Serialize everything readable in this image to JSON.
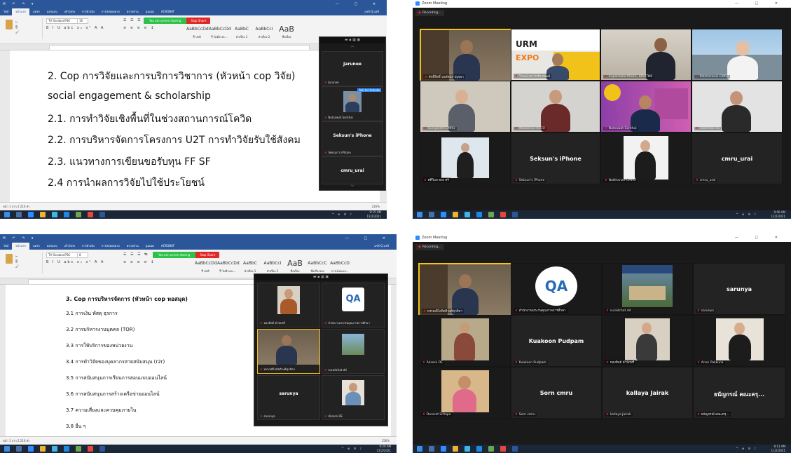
{
  "word_top": {
    "doc_lines": [
      "2. Cop การวิจัยและการบริการวิชาการ (หัวหน้า cop วิจัย)",
      "social engagement & scholarship",
      "2.1. การทำวิจัยเชิงพื้นที่ในช่วงสถานการณ์โควิด",
      "2.2. การบริหารจัดการโครงการ U2T การทำวิจัยรับใช้สังคม",
      "2.3. แนวทางการเขียนขอรับทุน FF  SF",
      "2.4 การนำผลการวิจัยไปใช้ประโยชน์"
    ],
    "font_box": "TH SarabunPSK",
    "font_size": "16",
    "share_text": "You are screen sharing",
    "stop_share": "Stop Share",
    "panel": {
      "tile1_name": "Jarunee",
      "tile1_mic_name": "Jarunee",
      "tile2_name": "Nutsawat Sonthai",
      "tile3_name": "Seksun's iPhone",
      "tile3_mic_name": "Seksun's iPhone",
      "tile4_name": "cmru_urai",
      "tile2_btn": "Ask to Unmute"
    },
    "tab_active": "หน้าแรก",
    "tabs_right": "แชร์ Q แชร์",
    "styles": [
      "AaBbCcDd",
      "AaBbCcDd",
      "AaBbC",
      "AaBbCcI",
      "AaB",
      "AaBbCcC",
      "AaBbCcD"
    ],
    "style_names": [
      "¶ ปกติ",
      "¶ ไม่มีระยะ...",
      "หัวเรื่อง 1",
      "หัวเรื่อง 2",
      "ชื่อเรื่อง",
      "ชื่อเรื่องรอง",
      "การเน้นแบบ..."
    ],
    "status_left": "หน้า 1 จาก 2   210 คำ",
    "status_right": "216%",
    "clock_time": "9:15 AM",
    "clock_date": "12/2/2021"
  },
  "word_bottom": {
    "doc_lines": [
      "3. Cop การบริหารจัดการ (หัวหน้า cop หอสมุด)",
      "3.1 การเงิน พัสดุ ธุรการ",
      "3.2 การบริหารงานบุคคล (TOR)",
      "3.3 การให้บริการของหน่วยงาน",
      "3.4 การทำวิจัยของบุคลากรสายสนับสนุน (r2r)",
      "3.5 การสนับสนุนการเรียนการสอนแบบออนไลน์",
      "3.6 การสนับสนุนการสร้างเครือข่ายออนไลน์",
      "3.7 ความเสี่ยงและควบคุมภายใน",
      "3.8 อื่น ๆ"
    ],
    "font_box": "TH SarabunPSK",
    "font_size": "8",
    "share_text": "You are screen sharing",
    "stop_share": "Stop Share",
    "panel": {
      "t1": "ทองทิพย์ คำนักศรี",
      "t2": "สำนักงานประกันคุณภาพการศึกษา",
      "t3": "พรรณพิไลกิตติวงศ์ศุภจิตฯ",
      "t4": "suradchat.dd",
      "t5": "sarunya",
      "t5_mic": "sarunya",
      "t6": "Aksara DE"
    },
    "status_left": "หน้า 1 จาก 2   210 คำ",
    "status_right": "156%",
    "clock_time": "9:20 AM",
    "clock_date": "11/2/2021"
  },
  "zoom_top": {
    "window_title": "Zoom Meeting",
    "recording": "Recording...",
    "tiles": [
      {
        "name": "ศักดิ์สิทธิ์ นพรัตน์กาญจนา",
        "label": ""
      },
      {
        "name": "วิวัฒน์ เชาว์ปรีชาพัฒน์",
        "label": ""
      },
      {
        "name": "Supachoke PSUFE. KMUTNB",
        "label": ""
      },
      {
        "name": "Patcharanoi CMRU",
        "label": ""
      },
      {
        "name": "Gunyarath CMRU",
        "label": ""
      },
      {
        "name": "Wasserine RSCO",
        "label": ""
      },
      {
        "name": "Nutsawat Sonthai",
        "label": ""
      },
      {
        "name": "Sakthsak OS",
        "label": ""
      },
      {
        "name": "ศศิวิมล ทอง ศรี",
        "label": ""
      },
      {
        "name": "Seksun's iPhone",
        "label": "Seksun's iPhone"
      },
      {
        "name": "Natthanan CMRU",
        "label": ""
      },
      {
        "name": "cmru_urai",
        "label": "cmru_urai"
      }
    ],
    "clock_time": "9:00 AM",
    "clock_date": "12/2/2021"
  },
  "zoom_bottom": {
    "window_title": "Zoom Meeting",
    "recording": "Recording...",
    "tiles": [
      {
        "name": "พรรณพิไลกิตติวงศ์ศุภจิตฯ",
        "label": ""
      },
      {
        "name": "สำนักงานประกันคุณภาพการศึกษา",
        "label": ""
      },
      {
        "name": "suradchat.dd",
        "label": ""
      },
      {
        "name": "sarunya",
        "label": "sarunya"
      },
      {
        "name": "Aksara DE",
        "label": ""
      },
      {
        "name": "Kuakoon Pudpam",
        "label": "Kuakoon Pudpam"
      },
      {
        "name": "ทองทิพย์ คำนักศรี",
        "label": ""
      },
      {
        "name": "Anon Pakkuna",
        "label": ""
      },
      {
        "name": "Dararat Sritapa",
        "label": ""
      },
      {
        "name": "Sorn cmru",
        "label": "Sorn cmru"
      },
      {
        "name": "kallaya Jairak",
        "label": "kallaya Jairak"
      },
      {
        "name": "ธนัญกรณ์ คณะครุ...",
        "label": "ธนัญกรณ์ คณะครุ..."
      }
    ],
    "clock_time": "9:11 AM",
    "clock_date": "11/2/2021"
  }
}
